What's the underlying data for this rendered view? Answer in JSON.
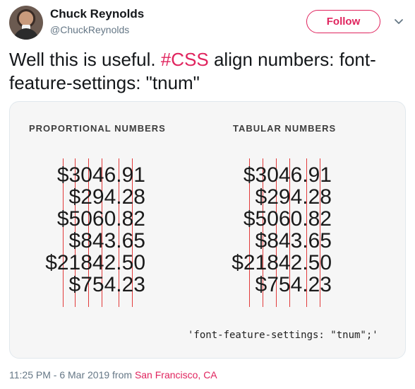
{
  "author": {
    "name": "Chuck Reynolds",
    "handle": "@ChuckReynolds"
  },
  "follow_label": "Follow",
  "tweet": {
    "text_before": "Well this is useful. ",
    "hashtag": "#CSS",
    "text_after": " align numbers: font-feature-settings: \"tnum\""
  },
  "media": {
    "left_title": "PROPORTIONAL NUMBERS",
    "right_title": "TABULAR NUMBERS",
    "left_numbers": [
      "$3046.91",
      "$294.28",
      "$5060.82",
      "$843.65",
      "$21842.50",
      "$754.23"
    ],
    "right_numbers": [
      "$3046.91",
      "$294.28",
      "$5060.82",
      "$843.65",
      "$21842.50",
      "$754.23"
    ],
    "code": "'font-feature-settings: \"tnum\";'"
  },
  "meta": {
    "timestamp": "11:25 PM - 6 Mar 2019 from ",
    "location": "San Francisco, CA"
  },
  "colors": {
    "accent": "#e0245e",
    "guide_line": "#e23b3b"
  },
  "icons": [
    "avatar",
    "chevron-down-icon"
  ]
}
